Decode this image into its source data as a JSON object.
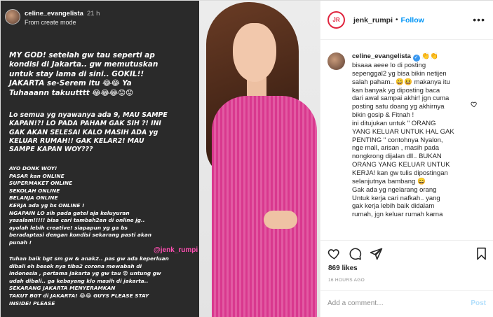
{
  "story": {
    "username": "celine_evangelista",
    "time": "21 h",
    "subtitle": "From create mode",
    "block_a": "MY GOD! setelah gw tau seperti ap\nkondisi di Jakarta.. gw memutuskan\nuntuk stay lama di sini.. GOKIL!!\nJAKARTA se-Serem itu 😂😂 Ya\nTuhaaann takuutttt 😂😂😂😟😟",
    "block_b": "Lo semua yg nyawanya ada 9, MAU SAMPE\nKAPAN!?! LO PADA PAHAM GAK SIH ?! INI\nGAK AKAN SELESAI KALO MASIH ADA yg\nKELUAR RUMAH!! GAK KELAR2! MAU\nSAMPE KAPAN WOY???",
    "block_c": "AYO DONK WOY!\nPASAR kan ONLINE\nSUPERMAKET ONLINE\nSEKOLAH ONLINE\nBELANJA ONLINE\nKERJA ada yg bs ONLINE !\nNGAPAIN LO sih pada gatel aja keluyuran\nyasalam!!!!! bisa cari tambah2an di online jg..\nayolah lebih creative! siapapun yg ga bs\nberadaptasi dengan kondisi sekarang pasti akan\npunah !",
    "block_d": "Tuhan baik bgt sm gw & anak2.. pas gw ada keperluan\ndibali eh besok nya tiba2 corona mewabah di\nindonesia , pertama jakarta yg gw tau 😨 untung gw\nudah dibali.. ga kebayang klo masih di jakarta..\nSEKARANG  JAKARTA MENYERAMKAN\nTAKUT BGT di JAKARTA! 😂😂 GUYS PLEASE STAY\nINSIDE! PLEASE",
    "watermark": "@jenk_rumpi"
  },
  "post": {
    "account": "jenk_rumpi",
    "separator": "•",
    "follow_label": "Follow",
    "logo_text": "JR",
    "caption_user": "celine_evangelista",
    "caption_verified_glyph": "✓",
    "caption_emojis": " 👏👏",
    "caption_text": "bisaaa aeee lo di posting\nsepenggal2 yg bisa bikin netijen\nsalah paham.. 😄😆 makanya itu\nkan banyak yg diposting baca\ndari awal sampai akhir! jgn cuma\nposting satu doang yg akhirnya\nbikin gosip & Fitnah !\nini ditujukan untuk \" ORANG\nYANG KELUAR UNTUK HAL GAK\nPENTING \" contohnya Nyalon,\nnge mall, arisan , masih pada\nnongkrong dijalan dll.. BUKAN\nORANG YANG KELUAR UNTUK\nKERJA! kan gw tulis dipostingan\nselanjutnya bambang 😄\nGak ada yg ngelarang orang\nUntuk kerja cari nafkah.. yang\ngak kerja lebih baik didalam\nrumah, jgn keluar rumah karna",
    "likes": "869 likes",
    "time_ago": "16 HOURS AGO",
    "comment_placeholder": "Add a comment…",
    "post_label": "Post",
    "more_glyph": "•••"
  },
  "colors": {
    "accent": "#0095f6",
    "watermark": "#ff4fb2",
    "story_bg": "#2a2a2a",
    "dress": "#d9388e"
  }
}
